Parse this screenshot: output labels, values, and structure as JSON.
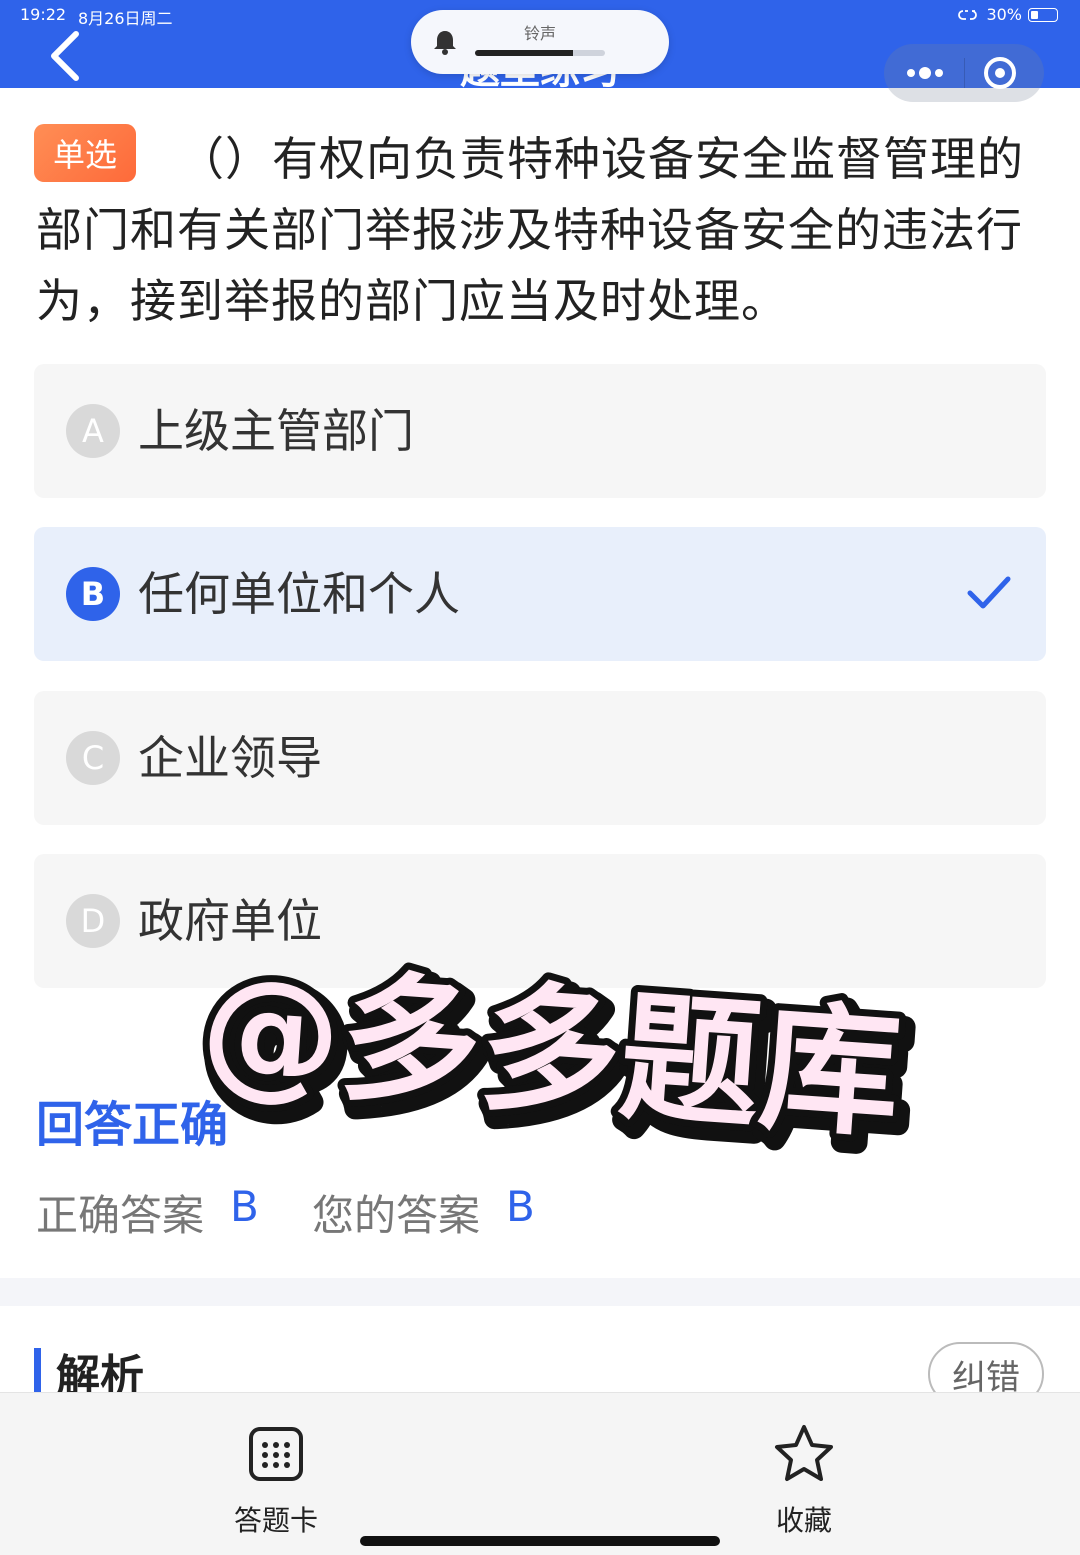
{
  "status_bar": {
    "time": "19:22",
    "date": "8月26日周二",
    "battery": "30%",
    "battery_level": 0.3
  },
  "header": {
    "title": "题型练习"
  },
  "ringer": {
    "label": "铃声",
    "level": 0.75
  },
  "question": {
    "type_badge": "单选",
    "text": "（）有权向负责特种设备安全监督管理的部门和有关部门举报涉及特种设备安全的违法行为，接到举报的部门应当及时处理。",
    "options": [
      {
        "letter": "A",
        "text": "上级主管部门",
        "selected": false
      },
      {
        "letter": "B",
        "text": "任何单位和个人",
        "selected": true
      },
      {
        "letter": "C",
        "text": "企业领导",
        "selected": false
      },
      {
        "letter": "D",
        "text": "政府单位",
        "selected": false
      }
    ]
  },
  "result": {
    "title": "回答正确",
    "correct_label": "正确答案",
    "correct_value": "B",
    "your_label": "您的答案",
    "your_value": "B"
  },
  "watermark": "@多多题库",
  "analysis": {
    "title": "解析",
    "correct_button": "纠错"
  },
  "bottom_bar": {
    "answer_card": "答题卡",
    "favorite": "收藏"
  },
  "colors": {
    "accent": "#2f63ea",
    "badge": "#fe6a3a"
  }
}
